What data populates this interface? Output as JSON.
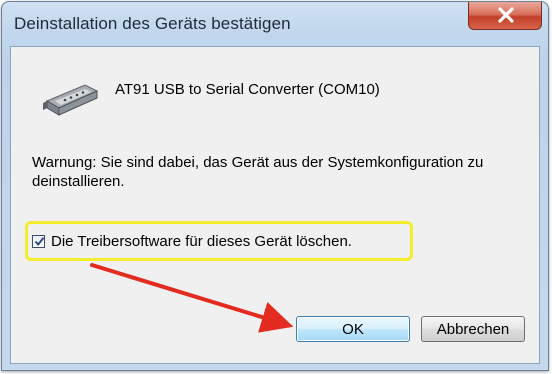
{
  "window": {
    "title": "Deinstallation des Geräts bestätigen",
    "close_icon": "close-x-icon"
  },
  "content": {
    "device_icon": "usb-serial-connector-icon",
    "device_name": "AT91 USB to Serial Converter (COM10)",
    "warning_text": "Warnung: Sie sind dabei, das Gerät aus der Systemkonfiguration zu deinstallieren.",
    "checkbox": {
      "label": "Die Treibersoftware für dieses Gerät löschen.",
      "checked": true
    }
  },
  "buttons": {
    "ok_label": "OK",
    "cancel_label": "Abbrechen"
  },
  "annotations": {
    "highlight_color": "#f3ee2c",
    "arrow_color": "#e32b1f"
  }
}
